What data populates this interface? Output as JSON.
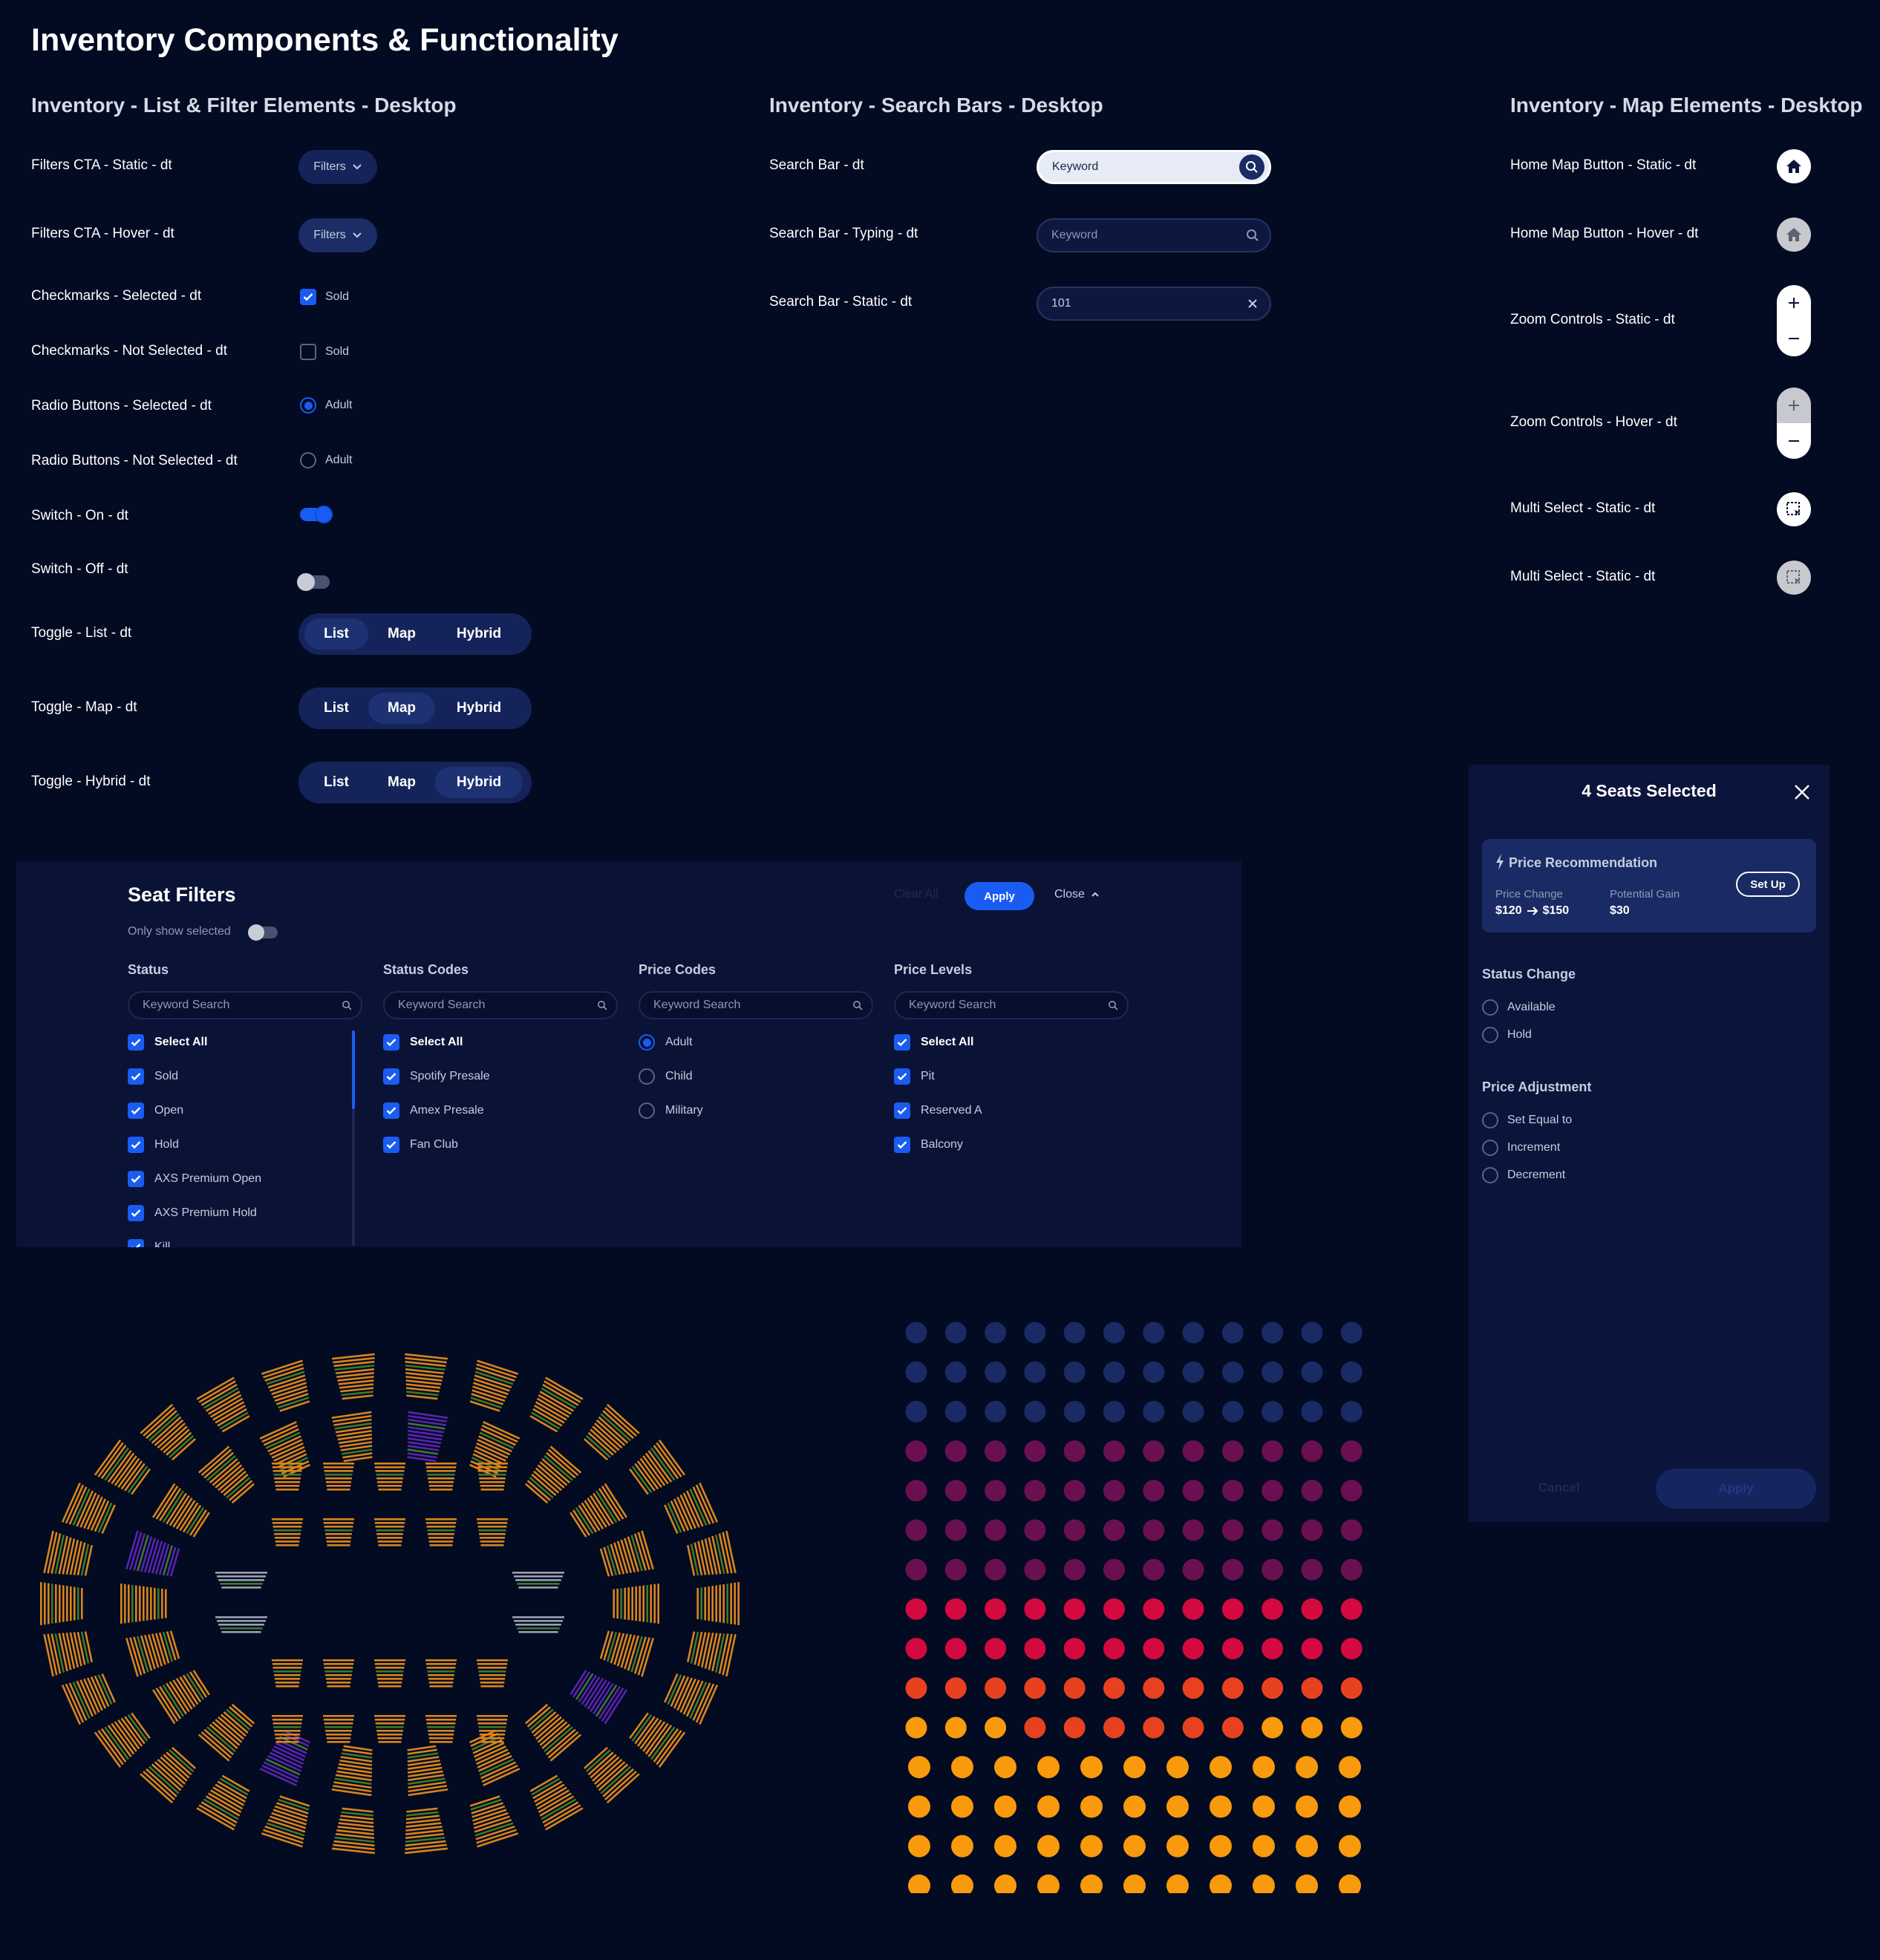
{
  "page_title": "Inventory Components & Functionality",
  "sections": {
    "list": "Inventory - List & Filter Elements - Desktop",
    "search": "Inventory - Search Bars - Desktop",
    "map": "Inventory - Map Elements - Desktop"
  },
  "list": {
    "filters_static": "Filters CTA - Static - dt",
    "filters_hover": "Filters CTA - Hover - dt",
    "filters_label": "Filters",
    "check_sel": "Checkmarks - Selected - dt",
    "check_not": "Checkmarks - Not Selected - dt",
    "check_label": "Sold",
    "radio_sel": "Radio Buttons - Selected - dt",
    "radio_not": "Radio Buttons - Not Selected - dt",
    "radio_label": "Adult",
    "switch_on": "Switch - On - dt",
    "switch_off": "Switch - Off - dt",
    "toggle_list": "Toggle - List - dt",
    "toggle_map": "Toggle - Map - dt",
    "toggle_hybrid": "Toggle - Hybrid - dt",
    "toggle_options": [
      "List",
      "Map",
      "Hybrid"
    ]
  },
  "search": {
    "static_label": "Search Bar - dt",
    "typing_label": "Search Bar - Typing - dt",
    "value_label": "Search Bar - Static - dt",
    "placeholder": "Keyword",
    "value": "101"
  },
  "map": {
    "home_static": "Home Map Button - Static - dt",
    "home_hover": "Home Map Button - Hover - dt",
    "zoom_static": "Zoom Controls - Static - dt",
    "zoom_hover": "Zoom Controls - Hover - dt",
    "multi_static": "Multi Select - Static - dt",
    "multi_static_2": "Multi Select - Static - dt"
  },
  "seat_filters": {
    "title": "Seat Filters",
    "only_selected": "Only show selected",
    "clear_all": "Clear All",
    "apply": "Apply",
    "close": "Close",
    "search_placeholder": "Keyword Search",
    "columns": [
      {
        "header": "Status",
        "type": "check",
        "items": [
          "Select All",
          "Sold",
          "Open",
          "Hold",
          "AXS Premium Open",
          "AXS Premium Hold",
          "Kill"
        ]
      },
      {
        "header": "Status Codes",
        "type": "check",
        "items": [
          "Select All",
          "Spotify Presale",
          "Amex Presale",
          "Fan Club"
        ]
      },
      {
        "header": "Price Codes",
        "type": "radio",
        "items": [
          "Adult",
          "Child",
          "Military"
        ]
      },
      {
        "header": "Price Levels",
        "type": "check",
        "items": [
          "Select All",
          "Pit",
          "Reserved A",
          "Balcony"
        ]
      }
    ]
  },
  "panel": {
    "title": "4 Seats Selected",
    "rec_title": "Price Recommendation",
    "price_change_label": "Price Change",
    "price_from": "$120",
    "price_to": "$150",
    "gain_label": "Potential Gain",
    "gain_value": "$30",
    "setup": "Set Up",
    "status_change": "Status Change",
    "status_options": [
      "Available",
      "Hold"
    ],
    "price_adjust": "Price Adjustment",
    "adjust_options": [
      "Set Equal to",
      "Increment",
      "Decrement"
    ],
    "cancel": "Cancel",
    "apply": "Apply"
  },
  "colors": {
    "background": "#020b22",
    "accent": "#1a5cf2",
    "panel": "#0b143a",
    "seat_available": "#1a2a64",
    "seat_purple": "#6a1050",
    "seat_pink": "#d4093f",
    "seat_red": "#e8411f",
    "seat_orange": "#f99a0c"
  }
}
